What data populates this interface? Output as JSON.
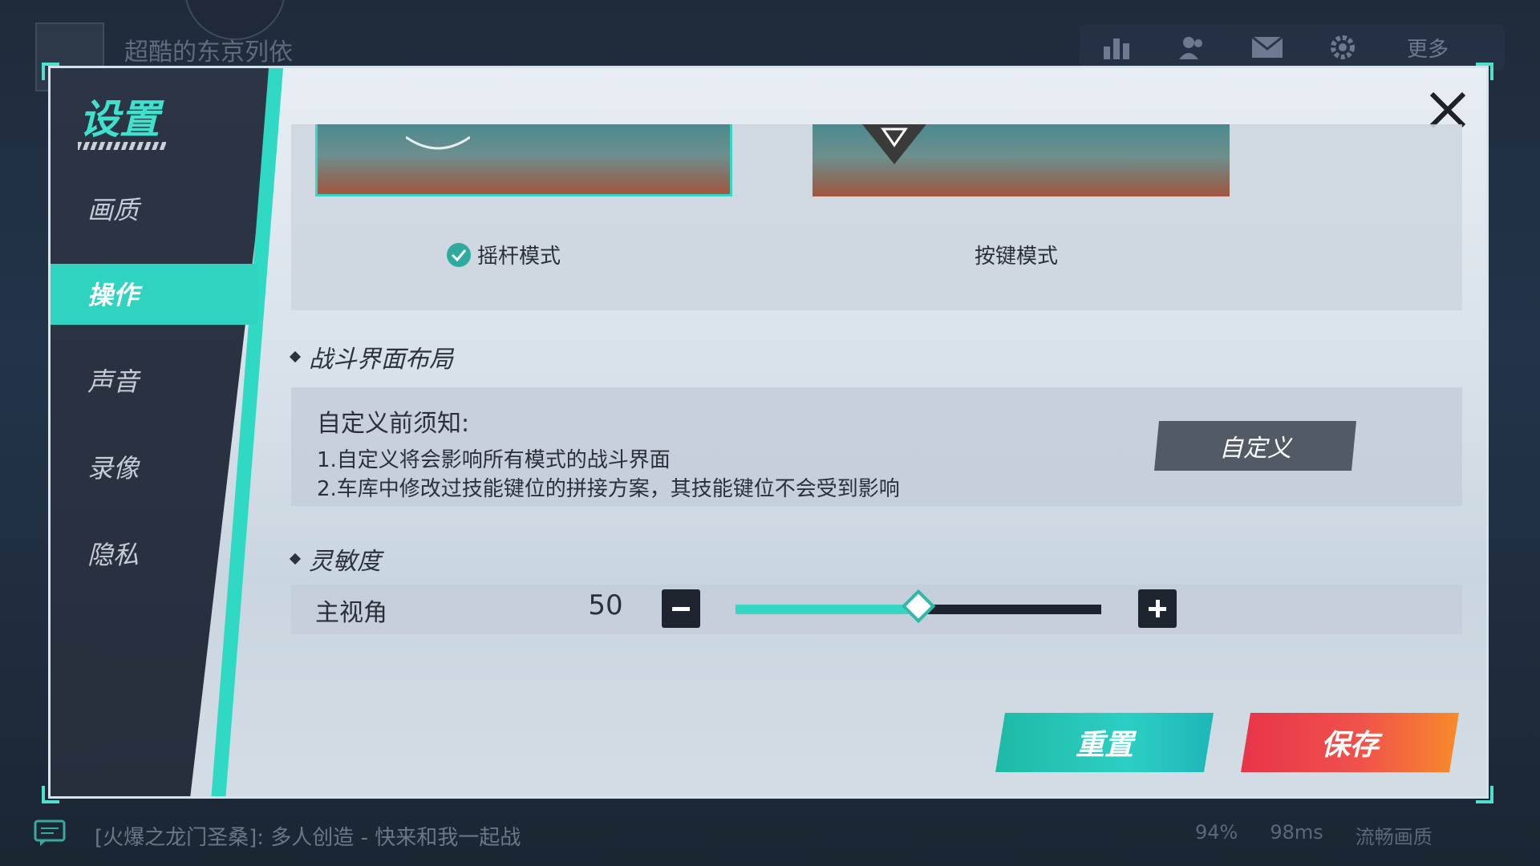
{
  "background": {
    "player_name": "超酷的东京列依",
    "more_label": "更多",
    "chat_message": "[火爆之龙门圣桑]: 多人创造 - 快来和我一起战",
    "battery": "94%",
    "ping": "98ms",
    "quality": "流畅画质"
  },
  "sidebar": {
    "title": "设置",
    "items": [
      {
        "label": "画质"
      },
      {
        "label": "操作"
      },
      {
        "label": "声音"
      },
      {
        "label": "录像"
      },
      {
        "label": "隐私"
      }
    ],
    "active_index": 1
  },
  "control_mode": {
    "options": [
      {
        "label": "摇杆模式",
        "selected": true
      },
      {
        "label": "按键模式",
        "selected": false
      }
    ]
  },
  "layout_section": {
    "title": "战斗界面布局",
    "notice_title": "自定义前须知:",
    "notice_lines": [
      "1.自定义将会影响所有模式的战斗界面",
      "2.车库中修改过技能键位的拼接方案，其技能键位不会受到影响"
    ],
    "customize_button": "自定义"
  },
  "sensitivity_section": {
    "title": "灵敏度",
    "main_view_label": "主视角",
    "main_view_value": "50",
    "slider_fraction": 0.5
  },
  "actions": {
    "reset_label": "重置",
    "save_label": "保存"
  },
  "colors": {
    "accent": "#2fd3bf",
    "save": "#ee3b4b",
    "active_marker": "#ee3b3b"
  }
}
